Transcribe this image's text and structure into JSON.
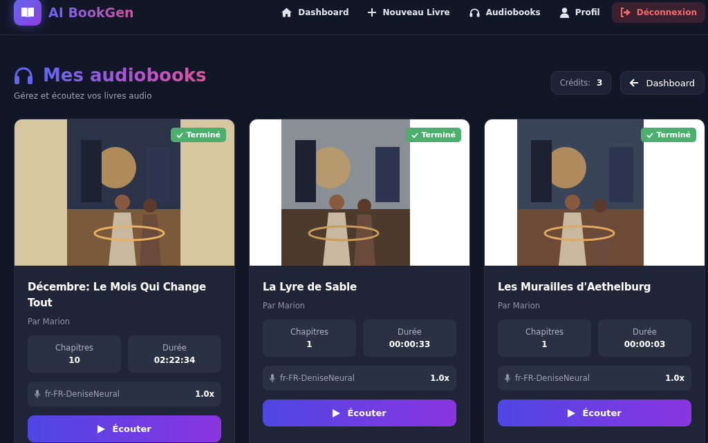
{
  "header": {
    "logo": "AI BookGen",
    "nav": [
      {
        "label": "Dashboard",
        "kind": "link"
      },
      {
        "label": "Nouveau Livre",
        "kind": "link"
      },
      {
        "label": "Audiobooks",
        "kind": "link"
      },
      {
        "label": "Profil",
        "kind": "link"
      },
      {
        "label": "Déconnexion",
        "kind": "danger"
      }
    ]
  },
  "page": {
    "title": "Mes audiobooks",
    "subtitle": "Gérez et écoutez vos livres audio",
    "credits_label": "Crédits:",
    "credits_value": "3",
    "back_button": "Dashboard"
  },
  "audiobooks": [
    {
      "status": "Terminé",
      "title": "Décembre: Le Mois Qui Change Tout",
      "author": "Par Marion",
      "stats": [
        {
          "label": "Chapitres",
          "value": "10"
        },
        {
          "label": "Durée",
          "value": "02:22:34"
        }
      ],
      "voice": "fr-FR-DeniseNeural",
      "speed": "1.0x",
      "button": "Écouter"
    },
    {
      "status": "Terminé",
      "title": "La Lyre de Sable",
      "author": "Par Marion",
      "stats": [
        {
          "label": "Chapitres",
          "value": "1"
        },
        {
          "label": "Durée",
          "value": "00:00:33"
        }
      ],
      "voice": "fr-FR-DeniseNeural",
      "speed": "1.0x",
      "button": "Écouter"
    },
    {
      "status": "Terminé",
      "title": "Les Murailles d'Aethelburg",
      "author": "Par Marion",
      "stats": [
        {
          "label": "Chapitres",
          "value": "1"
        },
        {
          "label": "Durée",
          "value": "00:00:03"
        }
      ],
      "voice": "fr-FR-DeniseNeural",
      "speed": "1.0x",
      "button": "Écouter"
    }
  ]
}
